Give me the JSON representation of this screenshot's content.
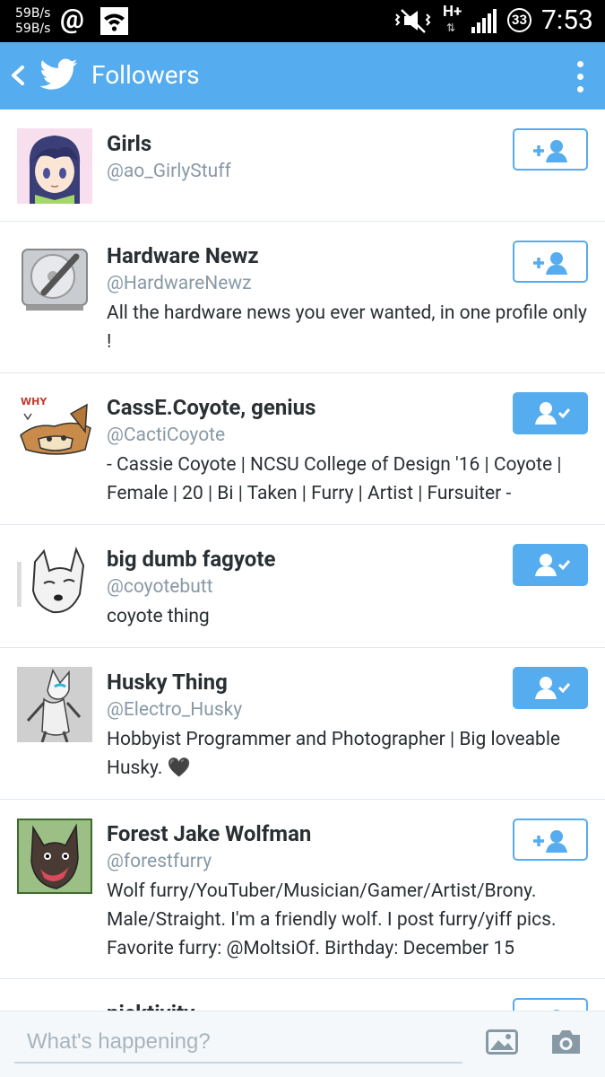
{
  "status_bar": {
    "speed_up": "59B/s",
    "speed_down": "59B/s",
    "at_symbol": "@",
    "network": "H+",
    "network_arrows": "⇅",
    "battery": "33",
    "time": "7:53"
  },
  "header": {
    "title": "Followers",
    "back_icon": "chevron-left-icon",
    "logo_icon": "twitter-bird-icon",
    "menu_icon": "overflow-menu-icon",
    "accent": "#55acee"
  },
  "followers": [
    {
      "name": "Girls",
      "handle": "@ao_GirlyStuff",
      "bio": "",
      "following": false,
      "avatar": "anime-girl-avatar"
    },
    {
      "name": "Hardware Newz",
      "handle": "@HardwareNewz",
      "bio": "All the hardware news you ever wanted, in one profile only !",
      "following": false,
      "avatar": "hard-drive-avatar"
    },
    {
      "name": "CassE.Coyote, genius",
      "handle": "@CactiCoyote",
      "bio": "- Cassie Coyote | NCSU College of Design '16 | Coyote | Female | 20 | Bi | Taken | Furry | Artist | Fursuiter -",
      "following": true,
      "avatar": "coyote-cartoon-avatar",
      "avatar_text": "WHY"
    },
    {
      "name": "big dumb fagyote",
      "handle": "@coyotebutt",
      "bio": "coyote thing",
      "following": true,
      "avatar": "wolf-sketch-avatar"
    },
    {
      "name": "Husky Thing",
      "handle": "@Electro_Husky",
      "bio": "Hobbyist Programmer and Photographer | Big loveable Husky. 🖤",
      "following": true,
      "avatar": "husky-drawing-avatar"
    },
    {
      "name": "Forest Jake Wolfman",
      "handle": "@forestfurry",
      "bio": "Wolf furry/YouTuber/Musician/Gamer/Artist/Brony. Male/Straight. I'm a friendly wolf. I post furry/yiff pics. Favorite furry: @MoltsiOf. Birthday: December 15",
      "following": false,
      "avatar": "wolf-cartoon-avatar"
    },
    {
      "name": "nicktivity",
      "handle": "",
      "bio": "",
      "following": false,
      "avatar": "dark-avatar"
    }
  ],
  "compose": {
    "placeholder": "What's happening?",
    "image_icon": "image-icon",
    "camera_icon": "camera-icon"
  }
}
